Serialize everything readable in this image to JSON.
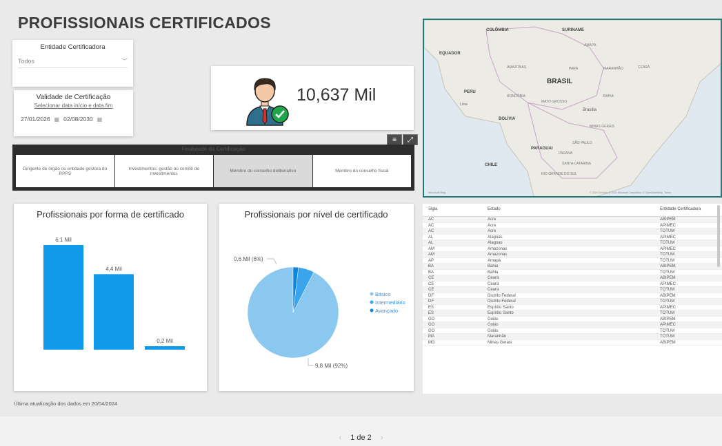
{
  "page_title": "PROFISSIONAIS CERTIFICADOS",
  "slicer_entidade": {
    "label": "Entidade Certificadora",
    "value": "Todos"
  },
  "slicer_validade": {
    "label": "Validade de Certificação",
    "link": "Selecionar data início e data fim",
    "date_start": "27/01/2026",
    "date_end": "02/08/2030"
  },
  "kpi": {
    "value": "10,637 Mil"
  },
  "filter_strip": {
    "header": "Finalidade da Certificação",
    "options": [
      "Dirigente de órgão ou entidade gestora do RPPS",
      "Investimentos: gestão ou comitê de investimentos",
      "Membro do conselho deliberativo",
      "Membro do conselho fiscal"
    ],
    "selected_index": 2
  },
  "map": {
    "labels": {
      "colombia": "COLÔMBIA",
      "suriname": "SURINAME",
      "equador": "EQUADOR",
      "amapa": "AMAPÁ",
      "amazonas": "AMAZONAS",
      "para": "PARÁ",
      "maranhao": "MARANHÃO",
      "ceara": "CEARÁ",
      "brasil": "BRASIL",
      "peru": "PERU",
      "lima": "Lima",
      "rondonia": "RONDÔNIA",
      "mato_grosso": "MATO GROSSO",
      "bahia": "BAHIA",
      "brasilia": "Brasília",
      "bolivia": "BOLÍVIA",
      "minas_gerais": "MINAS GERAIS",
      "paraguai": "PARAGUAI",
      "sao_paulo": "SÃO PAULO",
      "parana": "PARANÁ",
      "chile": "CHILE",
      "santa_catarina": "SANTA CATARINA",
      "rio_grande_sul": "RIO GRANDE DO SUL"
    },
    "brand": "Microsoft Bing",
    "copyright": "© 2024 TomTom, © 2024 Microsoft Corporation, © OpenStreetMap, Terms"
  },
  "bar_chart": {
    "title": "Profissionais por forma de certificado"
  },
  "pie_chart": {
    "title": "Profissionais por nível de certificado",
    "legend": [
      "Básico",
      "Intermediário",
      "Avançado"
    ],
    "label_small": "0,6 Mil (6%)",
    "label_large": "9,8 Mil (92%)"
  },
  "table": {
    "headers": [
      "Sigla",
      "Estado",
      "Entidade Certificadora"
    ],
    "rows": [
      [
        "AC",
        "Acre",
        "ABIPEM"
      ],
      [
        "AC",
        "Acre",
        "APIMEC"
      ],
      [
        "AC",
        "Acre",
        "TOTUM"
      ],
      [
        "AL",
        "Alagoas",
        "APIMEC"
      ],
      [
        "AL",
        "Alagoas",
        "TOTUM"
      ],
      [
        "AM",
        "Amazonas",
        "APIMEC"
      ],
      [
        "AM",
        "Amazonas",
        "TOTUM"
      ],
      [
        "AP",
        "Amapá",
        "TOTUM"
      ],
      [
        "BA",
        "Bahia",
        "ABIPEM"
      ],
      [
        "BA",
        "Bahia",
        "TOTUM"
      ],
      [
        "CE",
        "Ceará",
        "ABIPEM"
      ],
      [
        "CE",
        "Ceará",
        "APIMEC"
      ],
      [
        "CE",
        "Ceará",
        "TOTUM"
      ],
      [
        "DF",
        "Distrito Federal",
        "ABIPEM"
      ],
      [
        "DF",
        "Distrito Federal",
        "TOTUM"
      ],
      [
        "ES",
        "Espírito Santo",
        "APIMEC"
      ],
      [
        "ES",
        "Espírito Santo",
        "TOTUM"
      ],
      [
        "GO",
        "Goiás",
        "ABIPEM"
      ],
      [
        "GO",
        "Goiás",
        "APIMEC"
      ],
      [
        "GO",
        "Goiás",
        "TOTUM"
      ],
      [
        "MA",
        "Maranhão",
        "TOTUM"
      ],
      [
        "MG",
        "Minas Gerais",
        "ABIPEM"
      ]
    ]
  },
  "footer_note": "Última atualização dos dados em 20/04/2024",
  "pager": {
    "label": "1 de 2"
  },
  "chart_data": [
    {
      "type": "bar",
      "title": "Profissionais por forma de certificado",
      "categories": [
        "",
        "",
        ""
      ],
      "values": [
        6.1,
        4.4,
        0.2
      ],
      "data_labels": [
        "6,1 Mil",
        "4,4 Mil",
        "0,2 Mil"
      ],
      "ylim": [
        0,
        6.5
      ],
      "color": "#0f9bea"
    },
    {
      "type": "pie",
      "title": "Profissionais por nível de certificado",
      "labels": [
        "Básico",
        "Intermediário",
        "Avançado"
      ],
      "values": [
        9.8,
        0.6,
        0.2
      ],
      "colors": [
        "#8ac8f0",
        "#3aa5ec",
        "#0f86dc"
      ]
    }
  ]
}
